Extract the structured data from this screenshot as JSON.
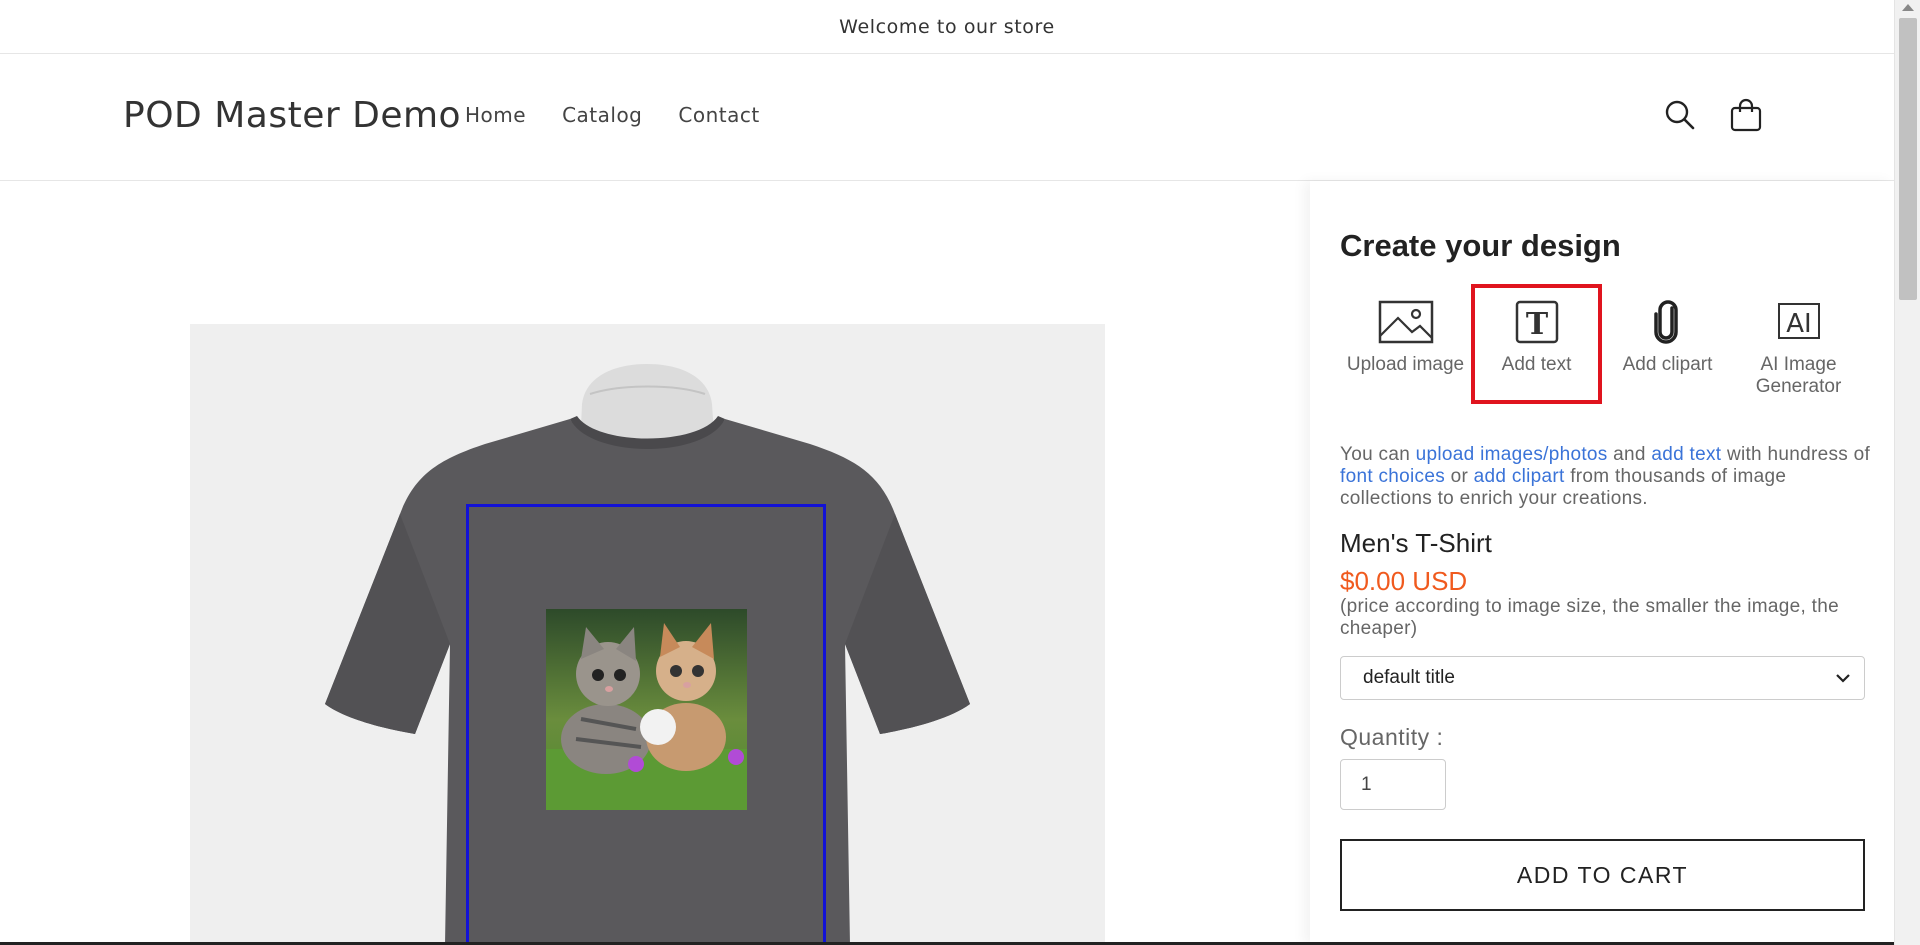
{
  "announcement": {
    "text": "Welcome to our store"
  },
  "header": {
    "brand": "POD Master Demo",
    "nav": [
      "Home",
      "Catalog",
      "Contact"
    ]
  },
  "designer": {
    "title": "Create your design",
    "tools": [
      {
        "label": "Upload image",
        "icon": "image-icon"
      },
      {
        "label": "Add text",
        "icon": "text-icon"
      },
      {
        "label": "Add clipart",
        "icon": "paperclip-icon"
      },
      {
        "label": "AI Image Generator",
        "icon": "ai-icon"
      }
    ],
    "description": {
      "p1": "You can ",
      "link1": "upload images/photos",
      "p2": " and ",
      "link2": "add text",
      "p3": " with hundress of ",
      "link3": "font choices",
      "p4": " or ",
      "link4": "add clipart",
      "p5": " from thousands of image collections to enrich your creations."
    },
    "product_title": "Men's T-Shirt",
    "price": "$0.00 USD",
    "price_note": "(price according to image size, the smaller the image, the cheaper)",
    "variant": "default title",
    "quantity_label": "Quantity :",
    "quantity": "1",
    "add_to_cart": "ADD TO CART"
  },
  "colors": {
    "print_area_border": "#1212d6",
    "highlight": "#e0141e",
    "price": "#f05a1e",
    "link": "#3a73d8",
    "shirt": "#5a595c"
  }
}
